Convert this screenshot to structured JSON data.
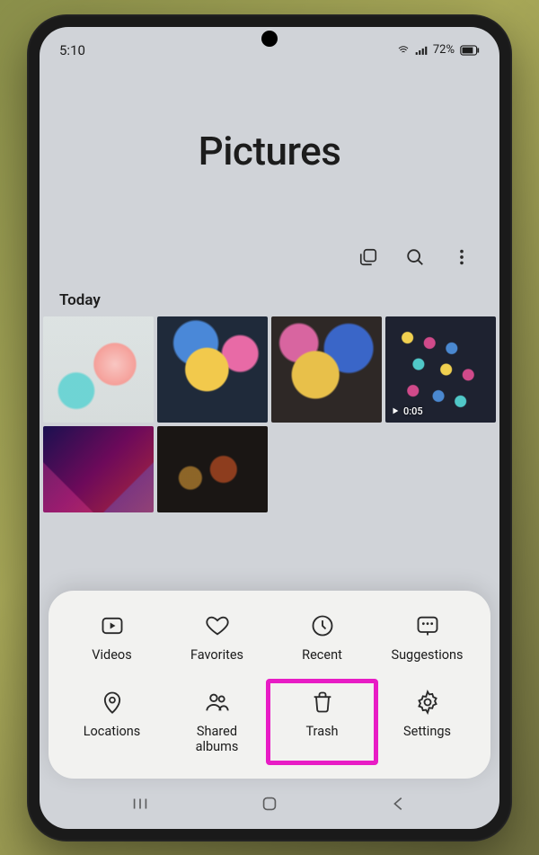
{
  "statusbar": {
    "time": "5:10",
    "battery": "72%"
  },
  "header": {
    "title": "Pictures"
  },
  "sections": {
    "today": "Today"
  },
  "video": {
    "duration": "0:05"
  },
  "sheet": {
    "videos": "Videos",
    "favorites": "Favorites",
    "recent": "Recent",
    "suggestions": "Suggestions",
    "locations": "Locations",
    "shared_albums": "Shared\nalbums",
    "trash": "Trash",
    "settings": "Settings"
  }
}
